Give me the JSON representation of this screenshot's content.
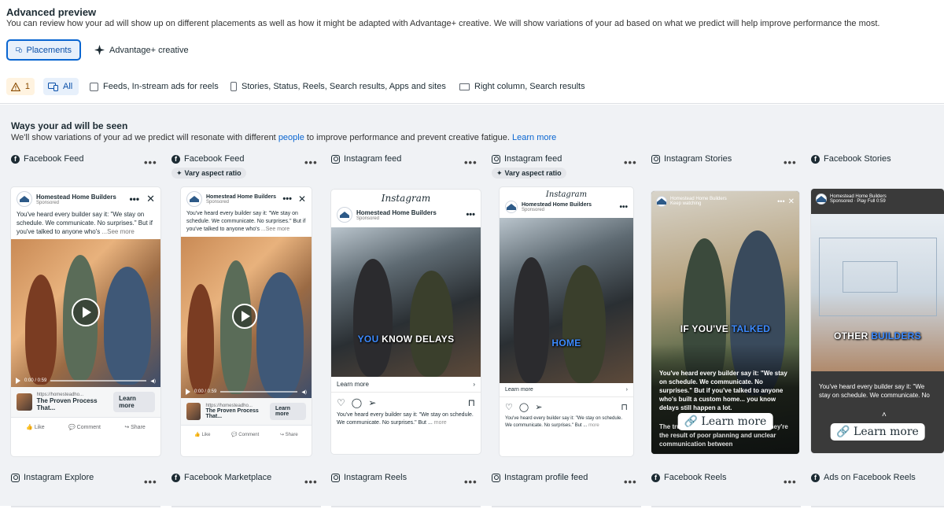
{
  "header": {
    "title": "Advanced preview",
    "subtitle": "You can review how your ad will show up on different placements as well as how it might be adapted with Advantage+ creative. We will show variations of your ad based on what we predict will help improve performance the most.",
    "tabs": [
      {
        "label": "Placements",
        "active": true
      },
      {
        "label": "Advantage+ creative",
        "active": false
      }
    ]
  },
  "filters": {
    "warning_count": "1",
    "all": "All",
    "feeds": "Feeds, In-stream ads for reels",
    "stories": "Stories, Status, Reels, Search results, Apps and sites",
    "right_column": "Right column, Search results"
  },
  "ways": {
    "title": "Ways your ad will be seen",
    "subtitle_pre": "We'll show variations of your ad we predict will resonate with different",
    "subtitle_link1": "people",
    "subtitle_mid": "to improve performance and prevent creative fatigue.",
    "subtitle_link2": "Learn more"
  },
  "placements_row1": [
    {
      "name": "Facebook Feed",
      "platform": "facebook"
    },
    {
      "name": "Facebook Feed",
      "platform": "facebook",
      "badge": "Vary aspect ratio"
    },
    {
      "name": "Instagram feed",
      "platform": "instagram"
    },
    {
      "name": "Instagram feed",
      "platform": "instagram",
      "badge": "Vary aspect ratio"
    },
    {
      "name": "Instagram Stories",
      "platform": "instagram"
    },
    {
      "name": "Facebook Stories",
      "platform": "facebook"
    }
  ],
  "placements_row2": [
    {
      "name": "Instagram Explore",
      "platform": "instagram"
    },
    {
      "name": "Facebook Marketplace",
      "platform": "facebook"
    },
    {
      "name": "Instagram Reels",
      "platform": "instagram"
    },
    {
      "name": "Instagram profile feed",
      "platform": "instagram"
    },
    {
      "name": "Facebook Reels",
      "platform": "facebook"
    },
    {
      "name": "Ads on Facebook Reels",
      "platform": "facebook"
    }
  ],
  "ad": {
    "advertiser": "Homestead Home Builders",
    "sponsored": "Sponsored",
    "play_sponsored": "Sponsored · Play Full 0:59",
    "story_sub": "Keep watching",
    "primary_text": "You've heard every builder say it: \"We stay on schedule. We communicate. No surprises.\" But if you've talked to anyone who's",
    "see_more": "...See more",
    "link_url": "https://homesteadho...",
    "link_url_short": "https://homesteadho...",
    "link_title": "The Proven Process That...",
    "cta": "Learn more",
    "video_time": "0:00 / 0:59",
    "like": "Like",
    "comment": "Comment",
    "share": "Share",
    "ig_brand": "Instagram",
    "ig_text": "You've heard every builder say it: \"We stay on schedule. We communicate. No surprises.\" But ...",
    "ig_more": "more",
    "caption_ig1_blue": "YOU",
    "caption_ig1_white": "KNOW DELAYS",
    "caption_ig2": "HOME",
    "caption_story_white": "IF YOU'VE",
    "caption_story_blue": "TALKED",
    "caption_fbs_white": "OTHER",
    "caption_fbs_blue": "BUILDERS",
    "story_text": "You've heard every builder say it: \"We stay on schedule. We communicate. No surprises.\" But if you've talked to anyone who's built a custom home... you know delays still happen a lot.",
    "story_text2": "The truth is, delays aren't bad luck. They're the result of poor planning and unclear communication between",
    "fbs_text": "You've heard every builder say it: \"We stay on schedule. We communicate. No"
  },
  "colors": {
    "accent": "#0a66d1",
    "page_bg": "#f0f2f5",
    "caption_blue": "#3d8bff"
  }
}
